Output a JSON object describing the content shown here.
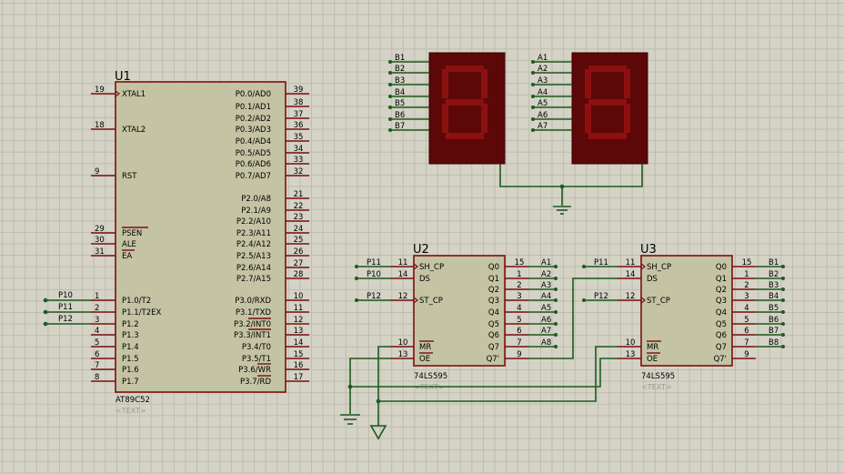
{
  "u1": {
    "ref": "U1",
    "part": "AT89C52",
    "text": "<TEXT>",
    "left_pins": [
      {
        "num": "19",
        "name": "XTAL1"
      },
      {
        "num": "18",
        "name": "XTAL2"
      },
      {
        "num": "9",
        "name": "RST"
      },
      {
        "num": "29",
        "name": "PSEN"
      },
      {
        "num": "30",
        "name": "ALE"
      },
      {
        "num": "31",
        "name": "EA"
      },
      {
        "num": "1",
        "name": "P1.0/T2"
      },
      {
        "num": "2",
        "name": "P1.1/T2EX"
      },
      {
        "num": "3",
        "name": "P1.2"
      },
      {
        "num": "4",
        "name": "P1.3"
      },
      {
        "num": "5",
        "name": "P1.4"
      },
      {
        "num": "6",
        "name": "P1.5"
      },
      {
        "num": "7",
        "name": "P1.6"
      },
      {
        "num": "8",
        "name": "P1.7"
      }
    ],
    "right_pins": [
      {
        "num": "39",
        "name": "P0.0/AD0"
      },
      {
        "num": "38",
        "name": "P0.1/AD1"
      },
      {
        "num": "37",
        "name": "P0.2/AD2"
      },
      {
        "num": "36",
        "name": "P0.3/AD3"
      },
      {
        "num": "35",
        "name": "P0.4/AD4"
      },
      {
        "num": "34",
        "name": "P0.5/AD5"
      },
      {
        "num": "33",
        "name": "P0.6/AD6"
      },
      {
        "num": "32",
        "name": "P0.7/AD7"
      },
      {
        "num": "21",
        "name": "P2.0/A8"
      },
      {
        "num": "22",
        "name": "P2.1/A9"
      },
      {
        "num": "23",
        "name": "P2.2/A10"
      },
      {
        "num": "24",
        "name": "P2.3/A11"
      },
      {
        "num": "25",
        "name": "P2.4/A12"
      },
      {
        "num": "26",
        "name": "P2.5/A13"
      },
      {
        "num": "27",
        "name": "P2.6/A14"
      },
      {
        "num": "28",
        "name": "P2.7/A15"
      },
      {
        "num": "10",
        "name": "P3.0/RXD"
      },
      {
        "num": "11",
        "name": "P3.1/TXD"
      },
      {
        "num": "12",
        "name": "P3.2/INT0"
      },
      {
        "num": "13",
        "name": "P3.3/INT1"
      },
      {
        "num": "14",
        "name": "P3.4/T0"
      },
      {
        "num": "15",
        "name": "P3.5/T1"
      },
      {
        "num": "16",
        "name": "P3.6/WR"
      },
      {
        "num": "17",
        "name": "P3.7/RD"
      }
    ],
    "net_labels": [
      "P10",
      "P11",
      "P12"
    ]
  },
  "u2": {
    "ref": "U2",
    "part": "74LS595",
    "text": "<TEXT>",
    "left_pins": [
      {
        "num": "11",
        "name": "SH_CP",
        "net": "P11"
      },
      {
        "num": "14",
        "name": "DS",
        "net": "P10"
      },
      {
        "num": "12",
        "name": "ST_CP",
        "net": "P12"
      },
      {
        "num": "10",
        "name": "MR",
        "net": ""
      },
      {
        "num": "13",
        "name": "OE",
        "net": ""
      }
    ],
    "right_pins": [
      {
        "num": "15",
        "name": "Q0",
        "net": "A1"
      },
      {
        "num": "1",
        "name": "Q1",
        "net": "A2"
      },
      {
        "num": "2",
        "name": "Q2",
        "net": "A3"
      },
      {
        "num": "3",
        "name": "Q3",
        "net": "A4"
      },
      {
        "num": "4",
        "name": "Q4",
        "net": "A5"
      },
      {
        "num": "5",
        "name": "Q5",
        "net": "A6"
      },
      {
        "num": "6",
        "name": "Q6",
        "net": "A7"
      },
      {
        "num": "7",
        "name": "Q7",
        "net": "A8"
      },
      {
        "num": "9",
        "name": "Q7'",
        "net": ""
      }
    ]
  },
  "u3": {
    "ref": "U3",
    "part": "74LS595",
    "text": "<TEXT>",
    "left_pins": [
      {
        "num": "11",
        "name": "SH_CP",
        "net": "P11"
      },
      {
        "num": "14",
        "name": "DS",
        "net": ""
      },
      {
        "num": "12",
        "name": "ST_CP",
        "net": "P12"
      },
      {
        "num": "10",
        "name": "MR",
        "net": ""
      },
      {
        "num": "13",
        "name": "OE",
        "net": ""
      }
    ],
    "right_pins": [
      {
        "num": "15",
        "name": "Q0",
        "net": "B1"
      },
      {
        "num": "1",
        "name": "Q1",
        "net": "B2"
      },
      {
        "num": "2",
        "name": "Q2",
        "net": "B3"
      },
      {
        "num": "3",
        "name": "Q3",
        "net": "B4"
      },
      {
        "num": "4",
        "name": "Q4",
        "net": "B5"
      },
      {
        "num": "5",
        "name": "Q5",
        "net": "B6"
      },
      {
        "num": "6",
        "name": "Q6",
        "net": "B7"
      },
      {
        "num": "7",
        "name": "Q7",
        "net": "B8"
      },
      {
        "num": "9",
        "name": "Q7'",
        "net": ""
      }
    ]
  },
  "display_b": {
    "nets": [
      "B1",
      "B2",
      "B3",
      "B4",
      "B5",
      "B6",
      "B7"
    ]
  },
  "display_a": {
    "nets": [
      "A1",
      "A2",
      "A3",
      "A4",
      "A5",
      "A6",
      "A7"
    ]
  },
  "colors": {
    "wire": "#1d5a1d",
    "pin": "#7a1010",
    "chip_body": "#c4c3a3",
    "display_body": "#5c0808",
    "segment": "#8c1010",
    "grid": "#bdbcae",
    "background": "#d4d3c6"
  }
}
